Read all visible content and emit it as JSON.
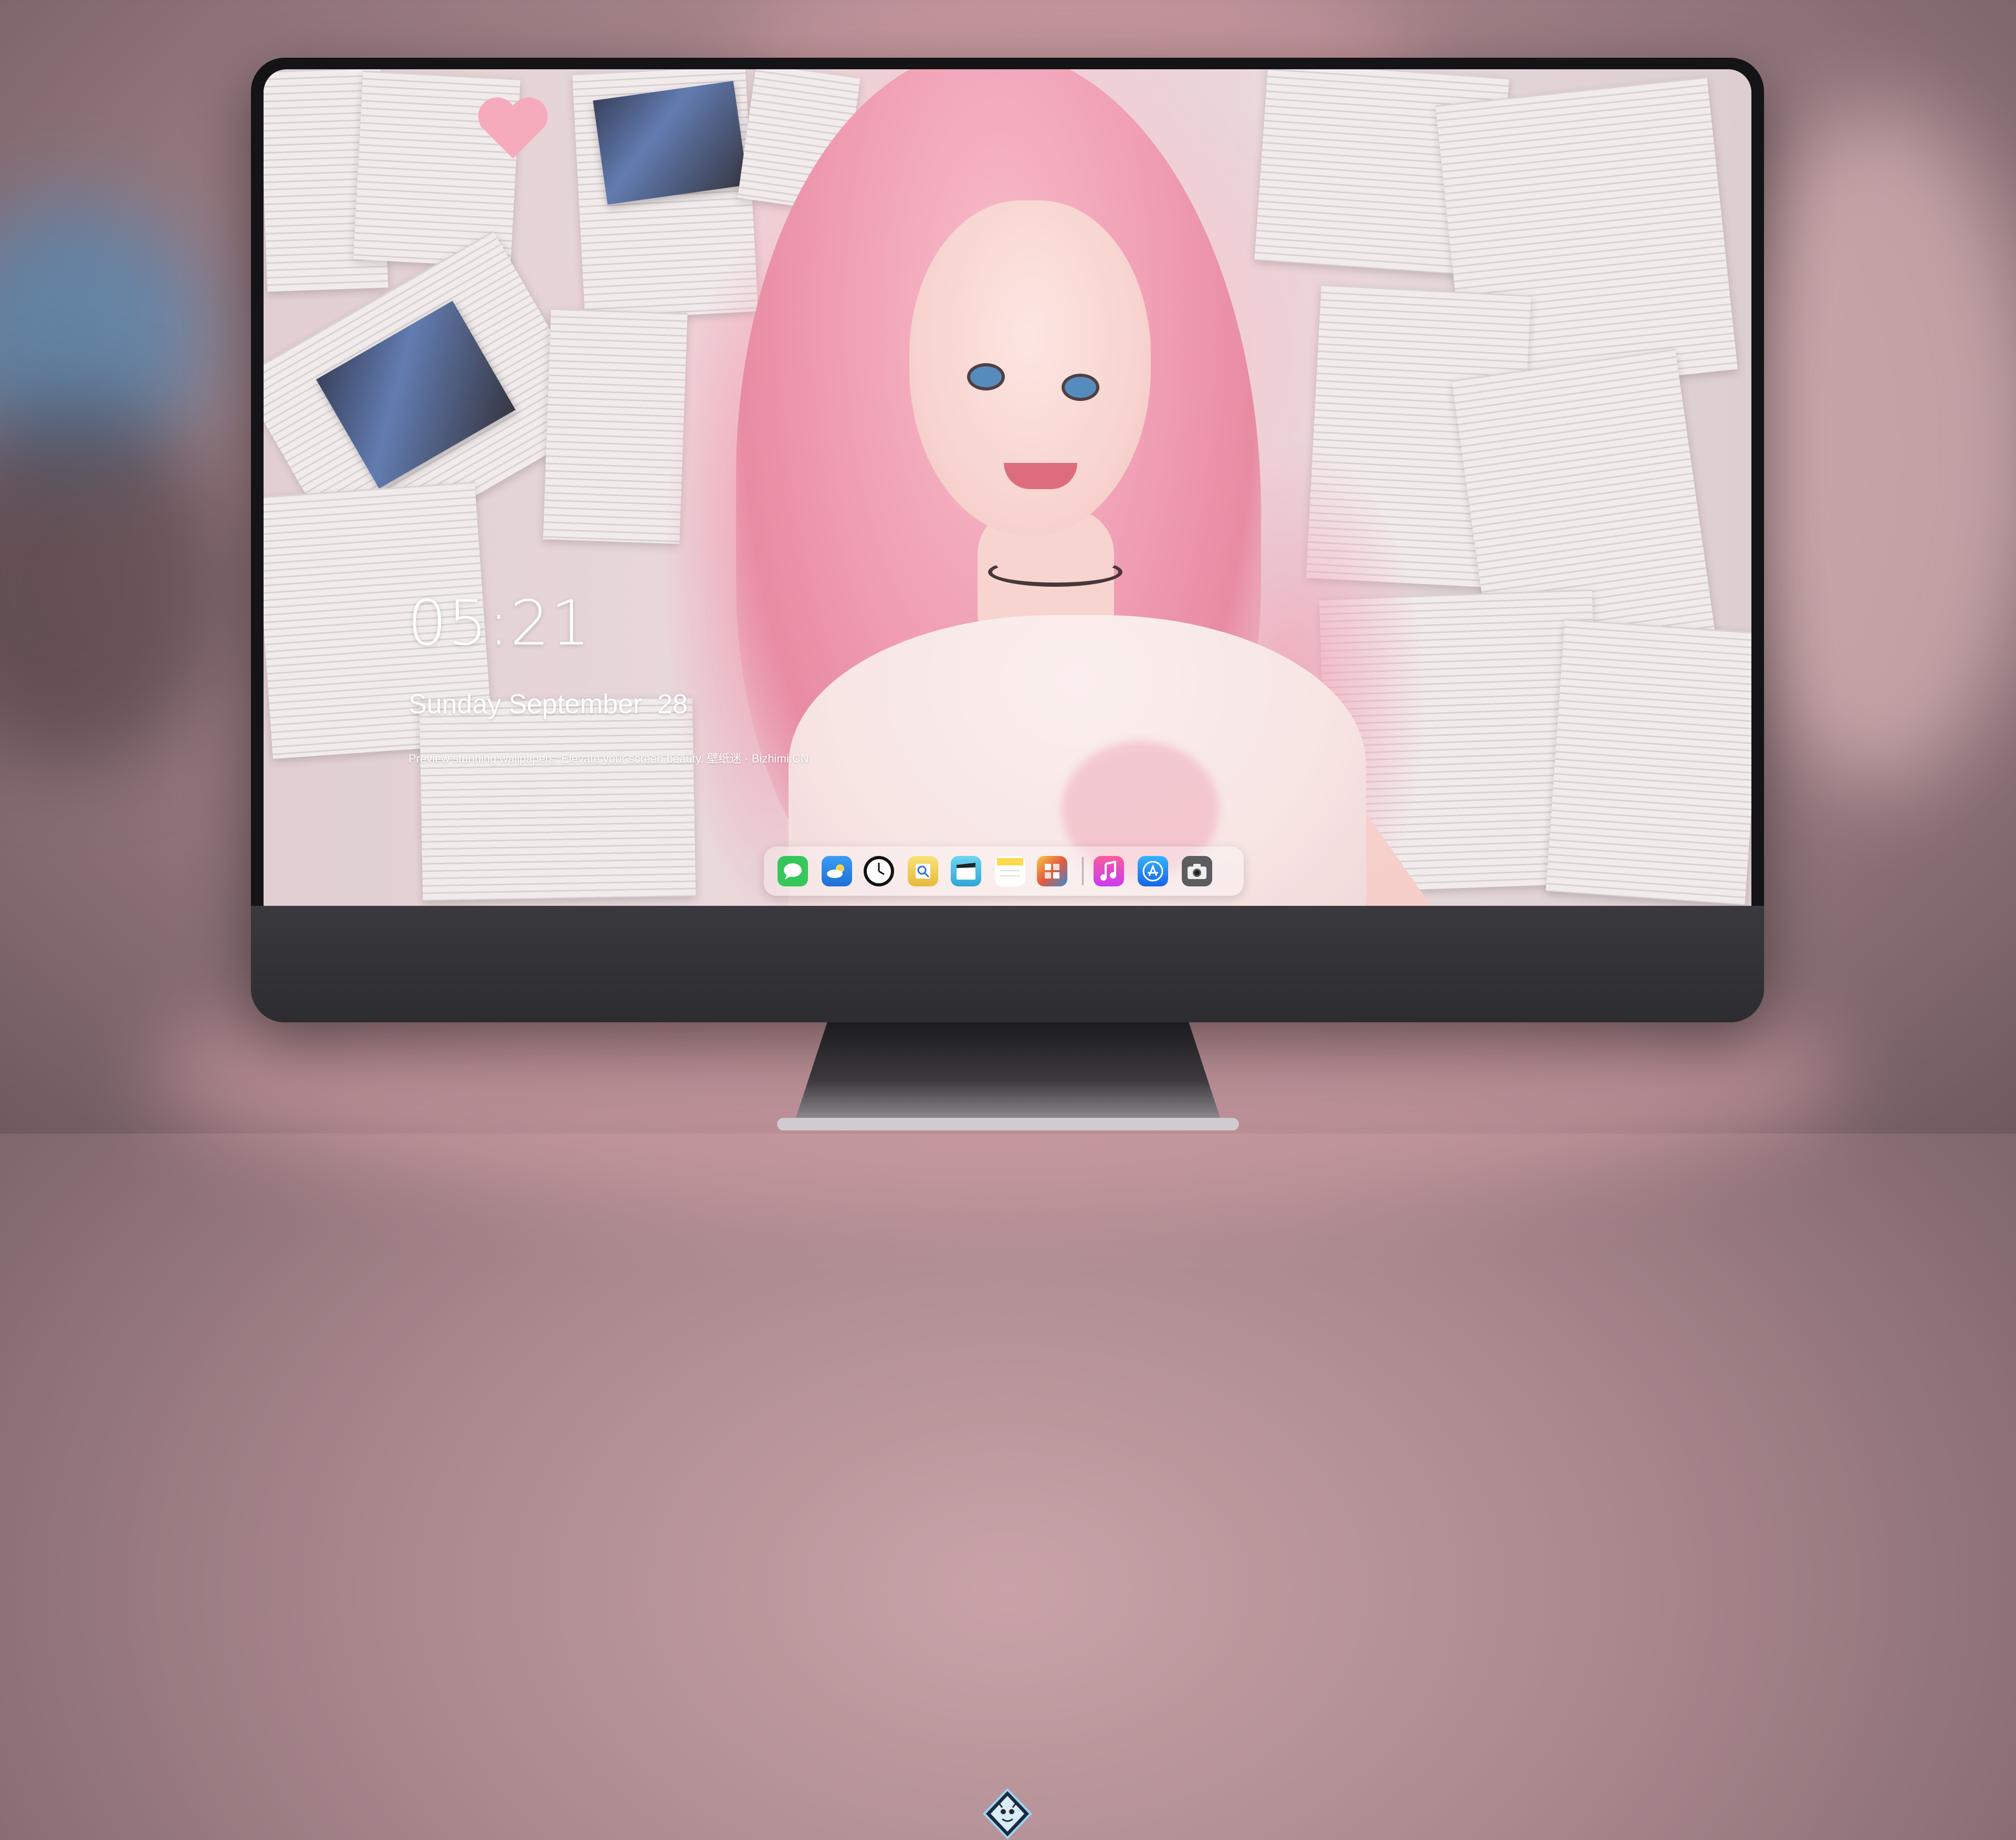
{
  "lockscreen": {
    "time": "05:21",
    "date": "Sunday September  28",
    "tagline": "Preview stunning wallpapers. Elevate your screen beauty. 壁纸迷 · Bizhimi.CN"
  },
  "dock": {
    "apps": [
      {
        "name": "Messages",
        "icon": "messages-icon",
        "color": "#35c759"
      },
      {
        "name": "Weather",
        "icon": "weather-icon",
        "color": "#2f8ff0"
      },
      {
        "name": "Clock",
        "icon": "clock-icon",
        "color": "#111111"
      },
      {
        "name": "Preview",
        "icon": "preview-icon",
        "color": "#f2d34a"
      },
      {
        "name": "Final Cut",
        "icon": "clapper-icon",
        "color": "#5bc4e8"
      },
      {
        "name": "Notes",
        "icon": "notes-icon",
        "color": "#ffd84d"
      },
      {
        "name": "Photo Booth",
        "icon": "photo-booth-icon",
        "color": "#e45a3a"
      },
      {
        "name": "Music",
        "icon": "music-icon",
        "color": "#f24d8c"
      },
      {
        "name": "App Store",
        "icon": "app-store-icon",
        "color": "#1d8cf5"
      },
      {
        "name": "Screenshot",
        "icon": "camera-icon",
        "color": "#6b6b6b"
      }
    ]
  },
  "colors": {
    "accent_pink": "#ee93aa",
    "bezel": "#141316",
    "chin": "#323135"
  }
}
